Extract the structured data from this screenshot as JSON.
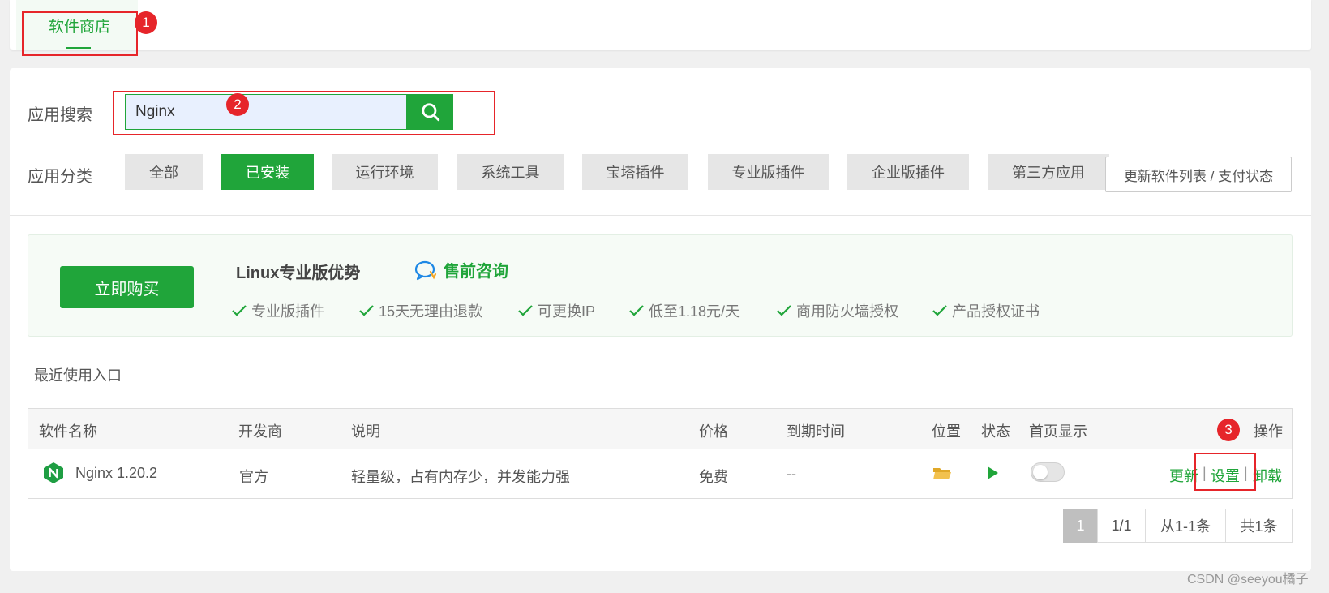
{
  "top_tab": {
    "label": "软件商店"
  },
  "annotations": {
    "n1": "1",
    "n2": "2",
    "n3": "3"
  },
  "search": {
    "label": "应用搜索",
    "value": "Nginx"
  },
  "category": {
    "label": "应用分类",
    "items": [
      "全部",
      "已安装",
      "运行环境",
      "系统工具",
      "宝塔插件",
      "专业版插件",
      "企业版插件",
      "第三方应用"
    ],
    "active_index": 1,
    "refresh_label": "更新软件列表 / 支付状态"
  },
  "promo": {
    "buy_label": "立即购买",
    "title": "Linux专业版优势",
    "consult_label": "售前咨询",
    "features": [
      "专业版插件",
      "15天无理由退款",
      "可更换IP",
      "低至1.18元/天",
      "商用防火墙授权",
      "产品授权证书"
    ]
  },
  "recent_label": "最近使用入口",
  "table": {
    "headers": {
      "name": "软件名称",
      "vendor": "开发商",
      "desc": "说明",
      "price": "价格",
      "expire": "到期时间",
      "location": "位置",
      "status": "状态",
      "homepage": "首页显示",
      "actions": "操作"
    },
    "row": {
      "name": "Nginx 1.20.2",
      "vendor": "官方",
      "desc": "轻量级，占有内存少，并发能力强",
      "price": "免费",
      "expire": "--",
      "homepage_enabled": false,
      "actions": {
        "update": "更新",
        "settings": "设置",
        "uninstall": "卸载",
        "sep": "|"
      }
    }
  },
  "pagination": {
    "current": "1",
    "pages": "1/1",
    "range": "从1-1条",
    "total": "共1条"
  },
  "watermark": "CSDN @seeyou橘子",
  "colors": {
    "accent": "#20a53a",
    "annotation": "#e6252a"
  }
}
